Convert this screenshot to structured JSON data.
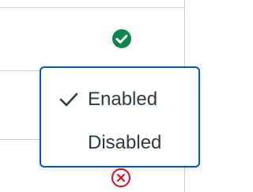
{
  "menu": {
    "items": [
      {
        "label": "Enabled",
        "checked": true,
        "icon": "checkmark-icon"
      },
      {
        "label": "Disabled",
        "checked": false
      }
    ],
    "border_color": "#0a5aa8"
  },
  "status": {
    "icon": "status-enabled-check-icon",
    "color": "#0b874b"
  },
  "row_below": {
    "icon": "status-disabled-x-icon",
    "color": "#e0061f"
  }
}
